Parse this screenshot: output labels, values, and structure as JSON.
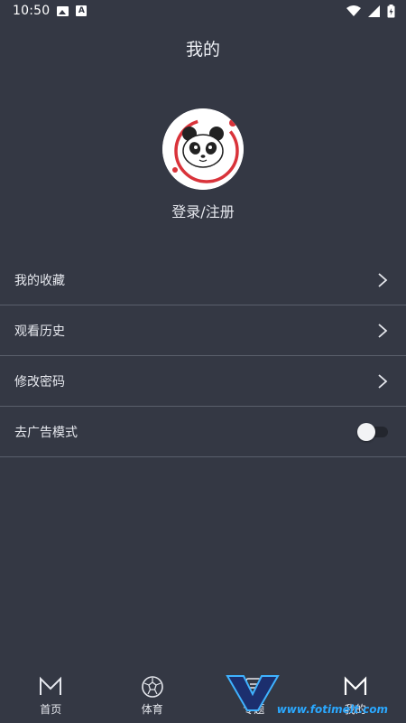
{
  "status_bar": {
    "time": "10:50"
  },
  "header": {
    "title": "我的"
  },
  "profile": {
    "login_label": "登录/注册"
  },
  "menu": {
    "items": [
      {
        "label": "我的收藏"
      },
      {
        "label": "观看历史"
      },
      {
        "label": "修改密码"
      }
    ],
    "ad_free": {
      "label": "去广告模式",
      "enabled": false
    }
  },
  "bottom_nav": {
    "items": [
      {
        "label": "首页",
        "icon": "logo-m-icon"
      },
      {
        "label": "体育",
        "icon": "soccer-ball-icon"
      },
      {
        "label": "专题",
        "icon": "topic-icon"
      },
      {
        "label": "我的",
        "icon": "logo-m-icon"
      }
    ]
  },
  "watermark": {
    "text": "www.fotimelt.com"
  },
  "colors": {
    "background": "#343844",
    "divider": "#5a5f6c",
    "text": "#e6e8ee",
    "accent": "#d9333a"
  }
}
